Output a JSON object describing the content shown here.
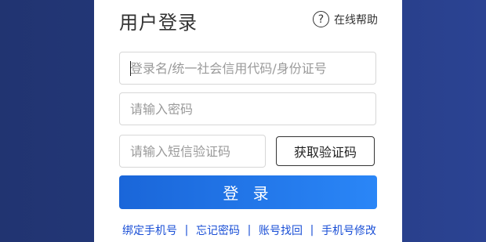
{
  "login": {
    "title": "用户登录",
    "help_label": "在线帮助",
    "help_icon_glyph": "?",
    "username_placeholder": "登录名/统一社会信用代码/身份证号",
    "password_placeholder": "请输入密码",
    "sms_placeholder": "请输入短信验证码",
    "get_code_label": "获取验证码",
    "submit_label": "登 录",
    "links": {
      "bind_phone": "绑定手机号",
      "forgot_password": "忘记密码",
      "recover_account": "账号找回",
      "change_phone": "手机号修改",
      "separator": "|"
    }
  },
  "colors": {
    "background": "#24397c",
    "primary_button": "#1f74ea",
    "link": "#1a4fd6"
  }
}
